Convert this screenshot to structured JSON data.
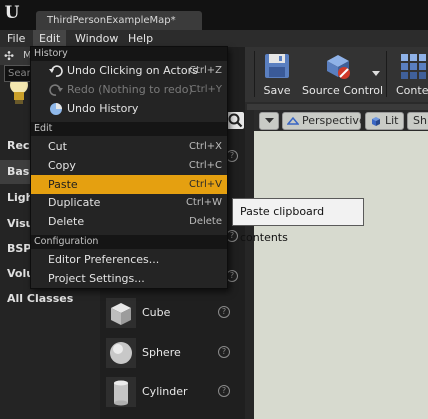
{
  "window": {
    "tab_title": "ThirdPersonExampleMap*"
  },
  "menubar": {
    "items": [
      "File",
      "Edit",
      "Window",
      "Help"
    ]
  },
  "left_panel": {
    "title_fragment": "M",
    "search_placeholder_fragment": "Search",
    "categories": [
      "Rece",
      "Basic",
      "Light",
      "Visua",
      "BSP",
      "Volur",
      "All Classes"
    ]
  },
  "placement_items": [
    {
      "label": "Cube",
      "icon": "cube-icon"
    },
    {
      "label": "Sphere",
      "icon": "sphere-icon"
    },
    {
      "label": "Cylinder",
      "icon": "cylinder-icon"
    }
  ],
  "toolbar": {
    "save_label": "Save",
    "source_control_label": "Source Control",
    "content_label": "Conten"
  },
  "viewport": {
    "perspective_label": "Perspective",
    "lit_label": "Lit",
    "show_label": "Sh"
  },
  "edit_menu": {
    "history_header": "History",
    "undo_label": "Undo Clicking on Actors",
    "undo_shortcut": "Ctrl+Z",
    "redo_label": "Redo (Nothing to redo)",
    "redo_shortcut": "Ctrl+Y",
    "undo_history_label": "Undo History",
    "edit_header": "Edit",
    "cut_label": "Cut",
    "cut_shortcut": "Ctrl+X",
    "copy_label": "Copy",
    "copy_shortcut": "Ctrl+C",
    "paste_label": "Paste",
    "paste_shortcut": "Ctrl+V",
    "duplicate_label": "Duplicate",
    "duplicate_shortcut": "Ctrl+W",
    "delete_label": "Delete",
    "delete_shortcut": "Delete",
    "config_header": "Configuration",
    "editor_prefs_label": "Editor Preferences...",
    "project_settings_label": "Project Settings..."
  },
  "tooltip": {
    "text": "Paste clipboard contents"
  },
  "colors": {
    "highlight": "#e5a010",
    "menu_bg": "#242424",
    "viewport_bg": "#d7dacf"
  }
}
